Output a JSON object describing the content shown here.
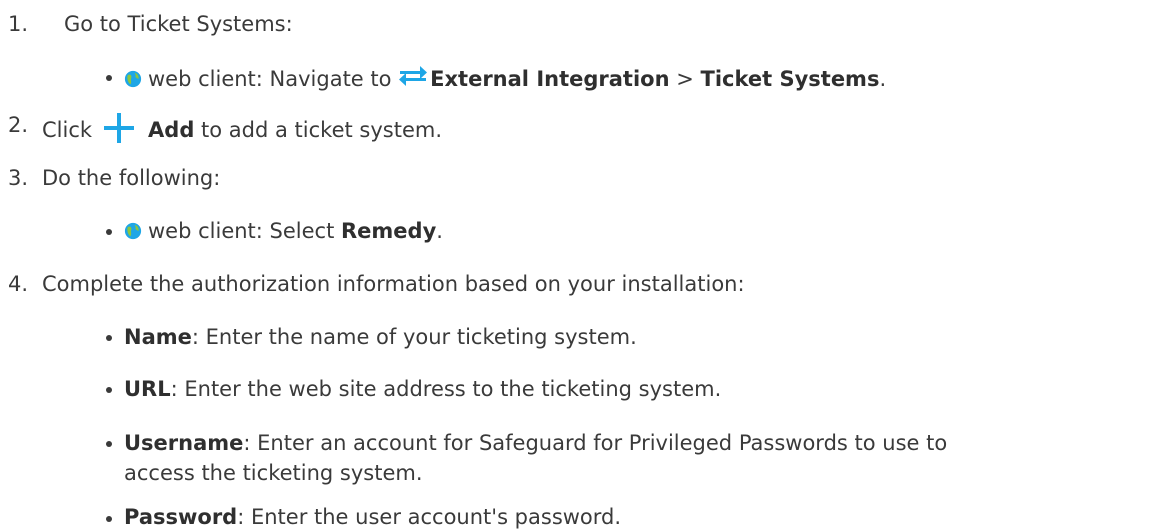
{
  "steps": [
    {
      "number": "1.",
      "text": "Go to Ticket Systems:",
      "sub": {
        "icon": "web-client-globe-icon",
        "prefix": "web client: Navigate to ",
        "nav_icon": "external-integration-arrows-icon",
        "bold1": "External Integration",
        "separator": " > ",
        "bold2": "Ticket Systems",
        "end": "."
      }
    },
    {
      "number": "2.",
      "pre": "Click",
      "icon": "add-plus-icon",
      "bold": "Add",
      "post": " to add a ticket system."
    },
    {
      "number": "3.",
      "text": "Do the following:",
      "sub": {
        "icon": "web-client-globe-icon",
        "prefix": "web client: Select ",
        "bold": "Remedy",
        "end": "."
      }
    },
    {
      "number": "4.",
      "text": "Complete the authorization information based on your installation:",
      "fields": [
        {
          "label": "Name",
          "text": ": Enter the name of your ticketing system."
        },
        {
          "label": "URL",
          "text": ": Enter the web site address to the ticketing system."
        },
        {
          "label": "Username",
          "text": ": Enter an account for Safeguard for Privileged Passwords to use to",
          "continuation": "access the ticketing system."
        },
        {
          "label": "Password",
          "text": ": Enter the user account's password."
        }
      ]
    }
  ],
  "colors": {
    "text": "#3a3a3a",
    "accent": "#1ea6e6",
    "globe_green": "#8dc63f"
  }
}
